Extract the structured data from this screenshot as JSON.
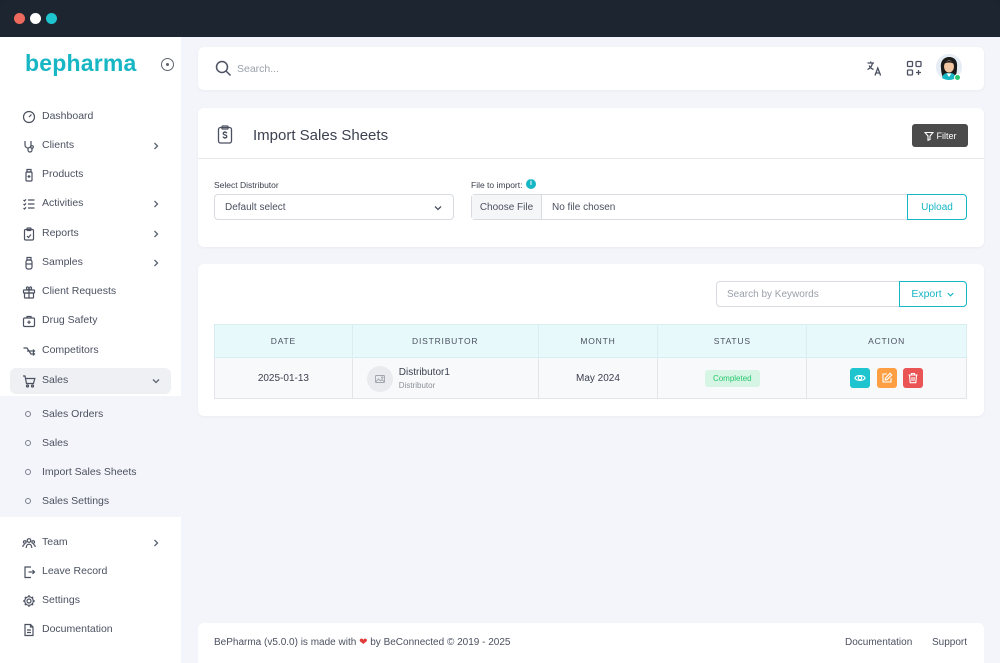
{
  "brand": "bepharma",
  "sidebar": {
    "items": [
      {
        "label": "Dashboard",
        "icon": "dashboard-icon",
        "chevron": false
      },
      {
        "label": "Clients",
        "icon": "stethoscope-icon",
        "chevron": true
      },
      {
        "label": "Products",
        "icon": "bottle-icon",
        "chevron": false
      },
      {
        "label": "Activities",
        "icon": "checklist-icon",
        "chevron": true
      },
      {
        "label": "Reports",
        "icon": "clipboard-icon",
        "chevron": true
      },
      {
        "label": "Samples",
        "icon": "vial-icon",
        "chevron": true
      },
      {
        "label": "Client Requests",
        "icon": "gift-icon",
        "chevron": false
      },
      {
        "label": "Drug Safety",
        "icon": "briefcase-icon",
        "chevron": false
      },
      {
        "label": "Competitors",
        "icon": "split-arrow-icon",
        "chevron": false
      },
      {
        "label": "Sales",
        "icon": "cart-icon",
        "chevron": true,
        "active": true
      }
    ],
    "sub_items": [
      "Sales Orders",
      "Sales",
      "Import Sales Sheets",
      "Sales Settings"
    ],
    "bottom_items": [
      {
        "label": "Team",
        "icon": "team-icon",
        "chevron": true
      },
      {
        "label": "Leave Record",
        "icon": "exit-icon",
        "chevron": false
      },
      {
        "label": "Settings",
        "icon": "gear-icon",
        "chevron": false
      },
      {
        "label": "Documentation",
        "icon": "document-icon",
        "chevron": false
      }
    ]
  },
  "topbar": {
    "search_placeholder": "Search..."
  },
  "import_card": {
    "title": "Import Sales Sheets",
    "filter_label": "Filter",
    "distributor_label": "Select Distributor",
    "distributor_value": "Default select",
    "file_label": "File to import:",
    "info_glyph": "i",
    "choose_label": "Choose File",
    "file_name": "No file chosen",
    "upload_label": "Upload"
  },
  "table_card": {
    "keyword_placeholder": "Search by Keywords",
    "export_label": "Export",
    "columns": [
      "DATE",
      "DISTRIBUTOR",
      "MONTH",
      "STATUS",
      "ACTION"
    ],
    "rows": [
      {
        "date": "2025-01-13",
        "distributor": "Distributor1",
        "distributor_role": "Distributor",
        "month": "May 2024",
        "status": "Completed"
      }
    ]
  },
  "footer": {
    "text_before": "BePharma (v5.0.0) is made with",
    "heart": "❤",
    "text_after": "by BeConnected © 2019 - 2025",
    "links": [
      "Documentation",
      "Support"
    ]
  },
  "colors": {
    "brand": "#17b6c4",
    "status_success": "#28c76f",
    "view": "#1ec5cf",
    "edit": "#ff9f43",
    "delete": "#ea5455"
  }
}
